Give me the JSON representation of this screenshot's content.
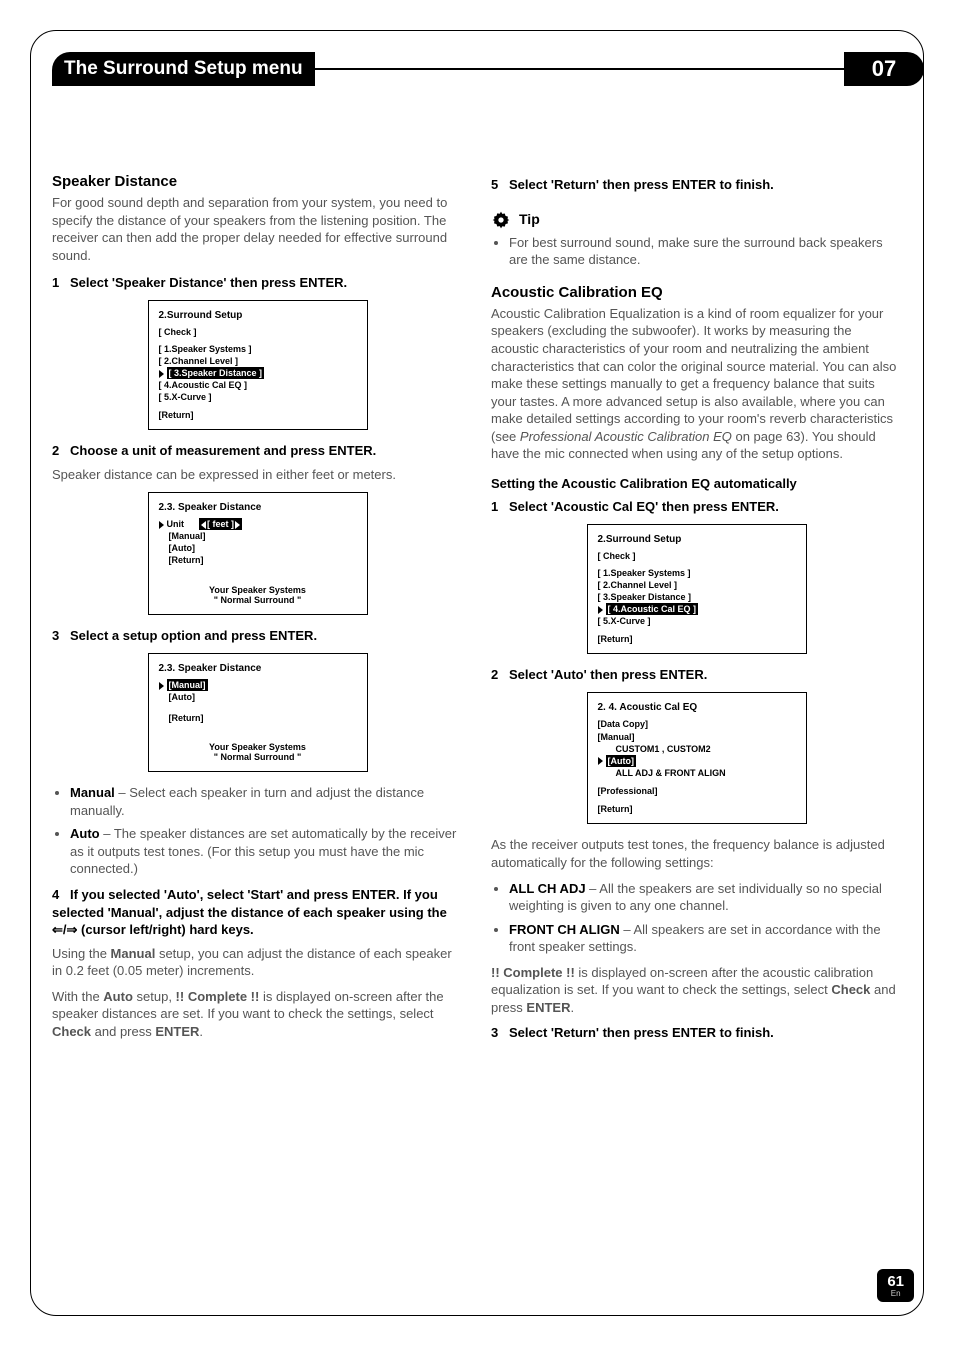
{
  "header": {
    "title": "The Surround Setup menu",
    "chapter": "07"
  },
  "page_number": "61",
  "page_lang": "En",
  "left": {
    "heading": "Speaker Distance",
    "intro": "For good sound depth and separation from your system, you need to specify the distance of your speakers from the listening position. The receiver can then add the proper delay needed for effective surround sound.",
    "step1": "Select 'Speaker Distance' then press ENTER.",
    "screen1": {
      "title": "2.Surround Setup",
      "sub": "[ Check ]",
      "items": [
        "[ 1.Speaker Systems ]",
        "[ 2.Channel Level ]",
        "[ 3.Speaker Distance ]",
        "[ 4.Acoustic Cal EQ ]",
        "[ 5.X-Curve ]"
      ],
      "hl_index": 2,
      "ret": "[Return]"
    },
    "step2": "Choose a unit of measurement and press ENTER.",
    "step2_after": "Speaker distance can be expressed in either feet or meters.",
    "screen2": {
      "title": "2.3. Speaker Distance",
      "unit_label": "Unit",
      "unit_value": "[ feet ]",
      "rows": [
        "[Manual]",
        "[Auto]",
        "[Return]"
      ],
      "sys1": "Your  Speaker  Systems",
      "sys2": "\"  Normal  Surround  \""
    },
    "step3": "Select a setup option and press ENTER.",
    "screen3": {
      "title": "2.3. Speaker Distance",
      "rows": [
        "[Manual]",
        "[Auto]"
      ],
      "hl_index": 0,
      "ret": "[Return]",
      "sys1": "Your  Speaker  Systems",
      "sys2": "\"  Normal  Surround  \""
    },
    "bullets": [
      {
        "b": "Manual",
        "t": " – Select each speaker in turn and adjust the distance manually."
      },
      {
        "b": "Auto",
        "t": " – The speaker distances are set automatically by the receiver as it outputs test tones. (For this setup you must have the mic connected.)"
      }
    ],
    "step4": "If you selected 'Auto', select 'Start' and press ENTER. If you selected 'Manual', adjust the distance of each speaker using the  ⇐/⇒  (cursor left/right) hard keys.",
    "after4a_pre": "Using the ",
    "after4a_b": "Manual",
    "after4a_post": " setup, you can adjust the distance of each speaker in 0.2 feet (0.05 meter) increments.",
    "after4b_pre": "With the ",
    "after4b_b1": "Auto",
    "after4b_mid1": " setup, ",
    "after4b_b2": "!! Complete !!",
    "after4b_mid2": " is displayed on-screen after the speaker distances are set. If you want to check the settings, select ",
    "after4b_b3": "Check",
    "after4b_mid3": " and press ",
    "after4b_b4": "ENTER",
    "after4b_end": "."
  },
  "right": {
    "step5": "Select 'Return' then press ENTER to finish.",
    "tip_label": "Tip",
    "tip_text": "For best surround sound, make sure the surround back speakers are the same distance.",
    "heading": "Acoustic Calibration EQ",
    "intro_a": "Acoustic Calibration Equalization is a kind of room equalizer for your speakers (excluding the subwoofer). It works by measuring the acoustic characteristics of your room and neutralizing the ambient characteristics that can color the original source material. You can also make these settings manually to get a frequency balance that suits your tastes. A more advanced setup is also available, where you can make detailed settings according to your room's reverb characteristics (see ",
    "intro_i": "Professional Acoustic Calibration EQ",
    "intro_b": " on page 63). You should have the mic connected when using any of the setup options.",
    "sub_heading": "Setting the Acoustic Calibration EQ automatically",
    "r_step1": "Select 'Acoustic Cal EQ' then press ENTER.",
    "screenA": {
      "title": "2.Surround Setup",
      "sub": "[ Check ]",
      "items": [
        "[ 1.Speaker Systems ]",
        "[ 2.Channel Level ]",
        "[ 3.Speaker Distance ]",
        "[ 4.Acoustic Cal EQ ]",
        "[ 5.X-Curve ]"
      ],
      "hl_index": 3,
      "ret": "[Return]"
    },
    "r_step2": "Select 'Auto' then press ENTER.",
    "screenB": {
      "title": "2. 4.  Acoustic   Cal   EQ",
      "rows": [
        "[Data Copy]",
        "[Manual]",
        "CUSTOM1 , CUSTOM2",
        "[Auto]",
        "ALL ADJ & FRONT ALIGN",
        "[Professional]",
        "[Return]"
      ],
      "hl_index": 3
    },
    "after_screens": "As the receiver outputs test tones, the frequency balance is adjusted automatically for the following settings:",
    "bullets": [
      {
        "b": "ALL CH ADJ",
        "t": " – All the speakers are set individually so no special weighting is given to any one channel."
      },
      {
        "b": "FRONT CH ALIGN",
        "t": " – All speakers are set in accordance with the front speaker settings."
      }
    ],
    "complete_b1": "!! Complete !!",
    "complete_mid1": " is displayed on-screen after the acoustic calibration equalization is set. If you want to check the settings, select ",
    "complete_b2": "Check",
    "complete_mid2": " and press ",
    "complete_b3": "ENTER",
    "complete_end": ".",
    "r_step3": "Select 'Return' then press ENTER to finish."
  }
}
